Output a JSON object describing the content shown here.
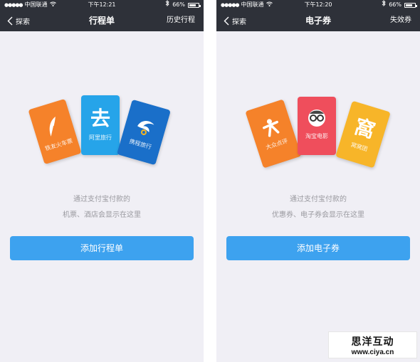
{
  "screens": [
    {
      "status": {
        "carrier": "中国联通",
        "time": "下午12:21",
        "battery": "66%"
      },
      "nav": {
        "back": "探索",
        "title": "行程单",
        "right": "历史行程"
      },
      "tickets": [
        {
          "label": "铁友火车票",
          "color": "#f5822a",
          "icon": "feather-icon"
        },
        {
          "label": "阿里旅行",
          "color": "#26a4e9",
          "icon": "qu-character-icon",
          "glyph": "去"
        },
        {
          "label": "携程旅行",
          "color": "#1a6fc9",
          "icon": "dolphin-icon"
        }
      ],
      "message": {
        "line1": "通过支付宝付款的",
        "line2": "机票、酒店会显示在这里"
      },
      "button": "添加行程单"
    },
    {
      "status": {
        "carrier": "中国联通",
        "time": "下午12:20",
        "battery": "66%"
      },
      "nav": {
        "back": "探索",
        "title": "电子券",
        "right": "失效券"
      },
      "tickets": [
        {
          "label": "大众点评",
          "color": "#f5822a",
          "icon": "person-icon"
        },
        {
          "label": "淘宝电影",
          "color": "#ef4e5c",
          "icon": "glasses-face-icon"
        },
        {
          "label": "窝窝团",
          "color": "#f7b529",
          "icon": "wo-character-icon",
          "glyph": "窩"
        }
      ],
      "message": {
        "line1": "通过支付宝付款的",
        "line2": "优惠券、电子券会显示在这里"
      },
      "button": "添加电子券"
    }
  ],
  "watermark": {
    "title": "思洋互动",
    "url": "www.ciya.cn"
  }
}
